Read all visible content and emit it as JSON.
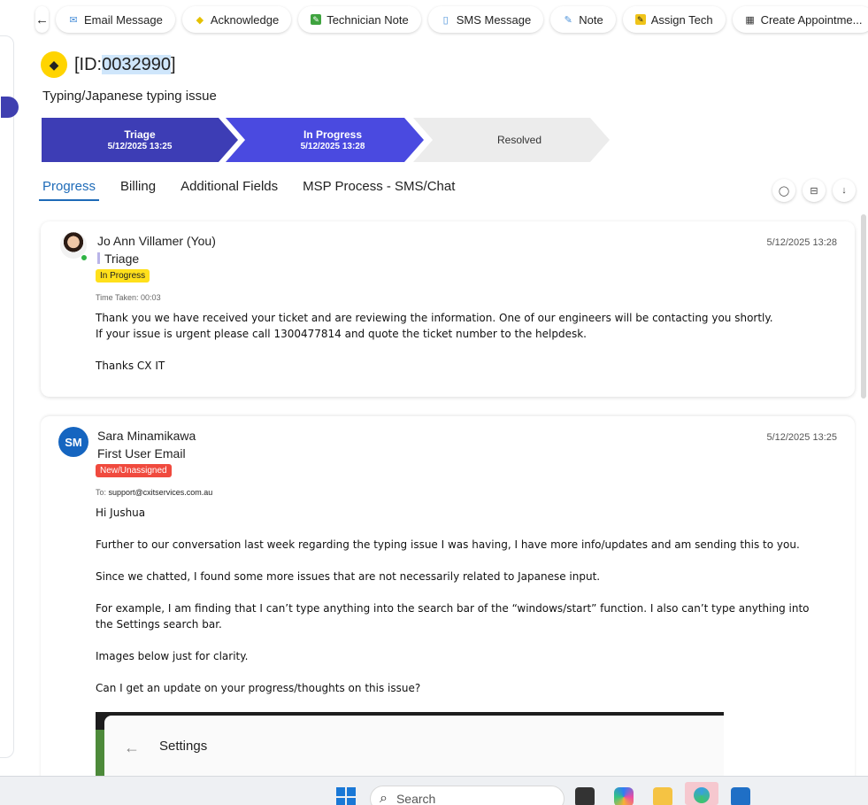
{
  "toolbar": {
    "back_label": "←",
    "buttons": [
      {
        "label": "Email Message",
        "icon": "envelope-icon",
        "glyph": "✉"
      },
      {
        "label": "Acknowledge",
        "icon": "acknowledge-icon",
        "glyph": "◆"
      },
      {
        "label": "Technician Note",
        "icon": "technician-note-icon",
        "glyph": "✎"
      },
      {
        "label": "SMS Message",
        "icon": "phone-icon",
        "glyph": "▯"
      },
      {
        "label": "Note",
        "icon": "note-icon",
        "glyph": "✎"
      },
      {
        "label": "Assign Tech",
        "icon": "assign-tech-icon",
        "glyph": "✎"
      },
      {
        "label": "Create Appointme...",
        "icon": "calendar-icon",
        "glyph": "▦"
      }
    ]
  },
  "ticket": {
    "id_prefix": "[ID:",
    "id_number": "0032990",
    "id_suffix": "]",
    "title": "Typing/Japanese typing issue",
    "badge_icon": "ticket-icon"
  },
  "stages": [
    {
      "name": "Triage",
      "time": "5/12/2025 13:25"
    },
    {
      "name": "In Progress",
      "time": "5/12/2025 13:28"
    },
    {
      "name": "Resolved",
      "time": ""
    }
  ],
  "tabs": [
    "Progress",
    "Billing",
    "Additional Fields",
    "MSP Process - SMS/Chat"
  ],
  "active_tab": "Progress",
  "tab_tools": [
    {
      "icon": "comment-icon",
      "glyph": "◯"
    },
    {
      "icon": "collapse-icon",
      "glyph": "⊟"
    },
    {
      "icon": "download-icon",
      "glyph": "↓"
    }
  ],
  "entries": [
    {
      "author": "Jo Ann Villamer (You)",
      "subtitle": "Triage",
      "status": "In Progress",
      "meta_label": "Time Taken:",
      "meta_value": "00:03",
      "timestamp": "5/12/2025 13:28",
      "lines": [
        "Thank you we have received your ticket and are reviewing the information. One of our engineers will be contacting you shortly.",
        "If your issue is urgent please call 1300477814 and quote the ticket number to the helpdesk.",
        "Thanks CX IT"
      ]
    },
    {
      "author": "Sara Minamikawa",
      "initials": "SM",
      "subtitle": "First User Email",
      "status": "New/Unassigned",
      "meta_label": "To:",
      "meta_value": "support@cxitservices.com.au",
      "timestamp": "5/12/2025 13:25",
      "lines": [
        "Hi Jushua",
        "Further to our conversation last week regarding the typing issue I was having, I have more info/updates and am sending this to you.",
        "Since we chatted, I found some more issues that are not necessarily related to Japanese input.",
        "For example, I am finding that I can’t type anything into the search bar of the “windows/start” function. I also can’t type anything into the Settings search bar.",
        "Images below just for clarity.",
        "Can I get an update on your progress/thoughts on this issue?"
      ],
      "embedded_image": {
        "back": "←",
        "title": "Settings"
      }
    }
  ],
  "taskbar": {
    "search_placeholder": "Search"
  }
}
